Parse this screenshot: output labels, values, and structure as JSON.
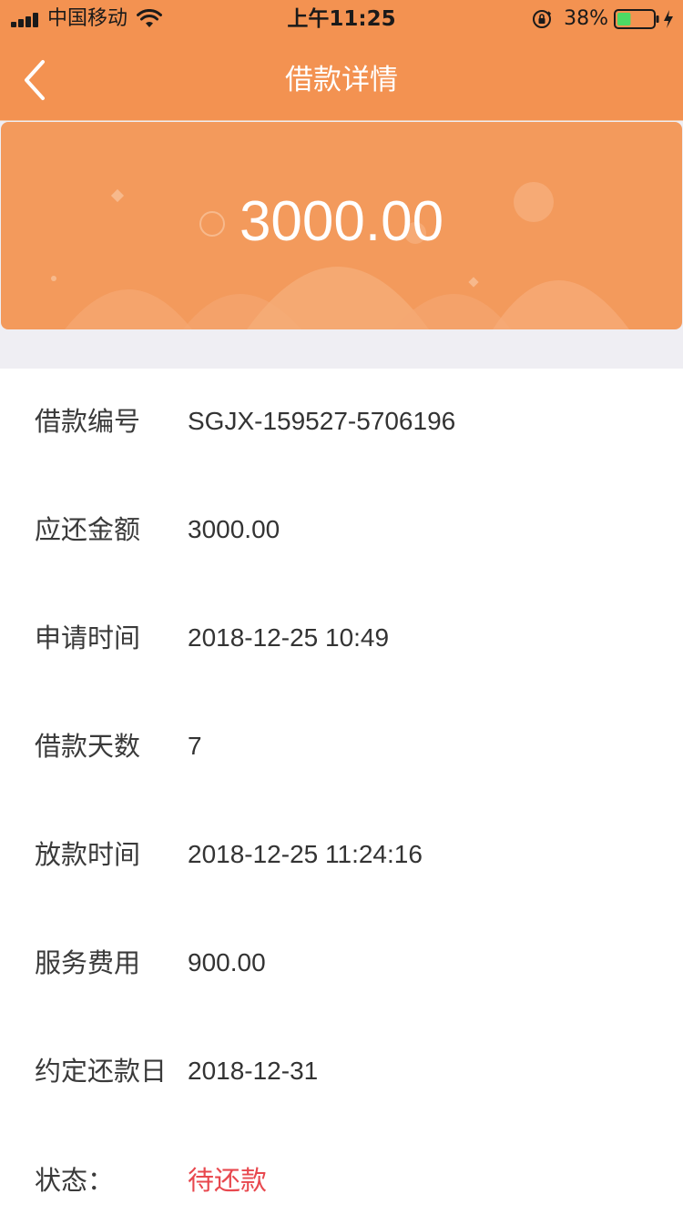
{
  "status_bar": {
    "carrier": "中国移动",
    "time": "上午11:25",
    "battery_percent": "38%",
    "battery_level": 0.38,
    "icons": [
      "signal-icon",
      "wifi-icon",
      "orientation-lock-icon",
      "battery-icon",
      "charging-bolt-icon"
    ]
  },
  "nav": {
    "title": "借款详情",
    "back_icon": "chevron-left-icon"
  },
  "hero": {
    "amount": "3000.00"
  },
  "details": [
    {
      "label": "借款编号",
      "value": "SGJX-159527-5706196"
    },
    {
      "label": "应还金额",
      "value": "3000.00"
    },
    {
      "label": "申请时间",
      "value": "2018-12-25 10:49"
    },
    {
      "label": "借款天数",
      "value": "7"
    },
    {
      "label": "放款时间",
      "value": "2018-12-25 11:24:16"
    },
    {
      "label": "服务费用",
      "value": "900.00"
    },
    {
      "label": "约定还款日",
      "value": "2018-12-31"
    },
    {
      "label": "状态：",
      "value": "待还款"
    }
  ],
  "colors": {
    "header_orange": "#f39251",
    "card_orange": "#f39a5c",
    "status_red": "#e8484e",
    "page_gray": "#efeef3",
    "battery_green": "#4cd964"
  }
}
